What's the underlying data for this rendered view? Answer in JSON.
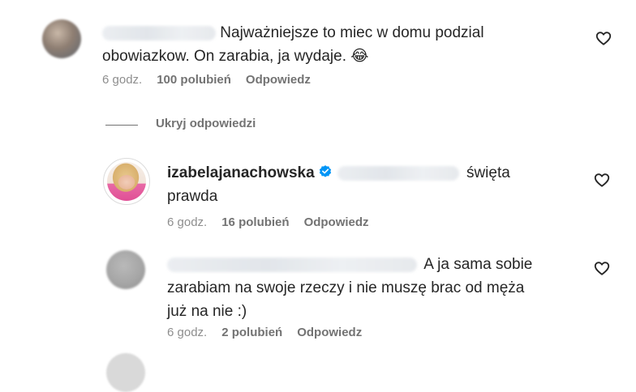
{
  "comments": [
    {
      "text": "Najważniejsze to miec w domu podzial obowiazkow. On zarabia, ja wydaje.",
      "emoji": "😂",
      "time": "6 godz.",
      "likes": "100 polubień",
      "reply": "Odpowiedz"
    }
  ],
  "hide_replies": "Ukryj odpowiedzi",
  "replies": [
    {
      "username": "izabelajanachowska",
      "text_inline": "święta",
      "text_rest": "prawda",
      "time": "6 godz.",
      "likes": "16 polubień",
      "reply": "Odpowiedz"
    },
    {
      "text_inline": "A ja sama sobie",
      "text_rest_1": "zarabiam na swoje rzeczy i nie muszę brac od męża",
      "text_rest_2": "już na nie :)",
      "time": "6 godz.",
      "likes": "2 polubień",
      "reply": "Odpowiedz"
    }
  ],
  "icons": {
    "like": "heart-outline-icon",
    "verified": "verified-badge-icon"
  },
  "colors": {
    "text": "#262626",
    "secondary": "#8e8e8e",
    "verified": "#0095f6",
    "background": "#ffffff"
  }
}
